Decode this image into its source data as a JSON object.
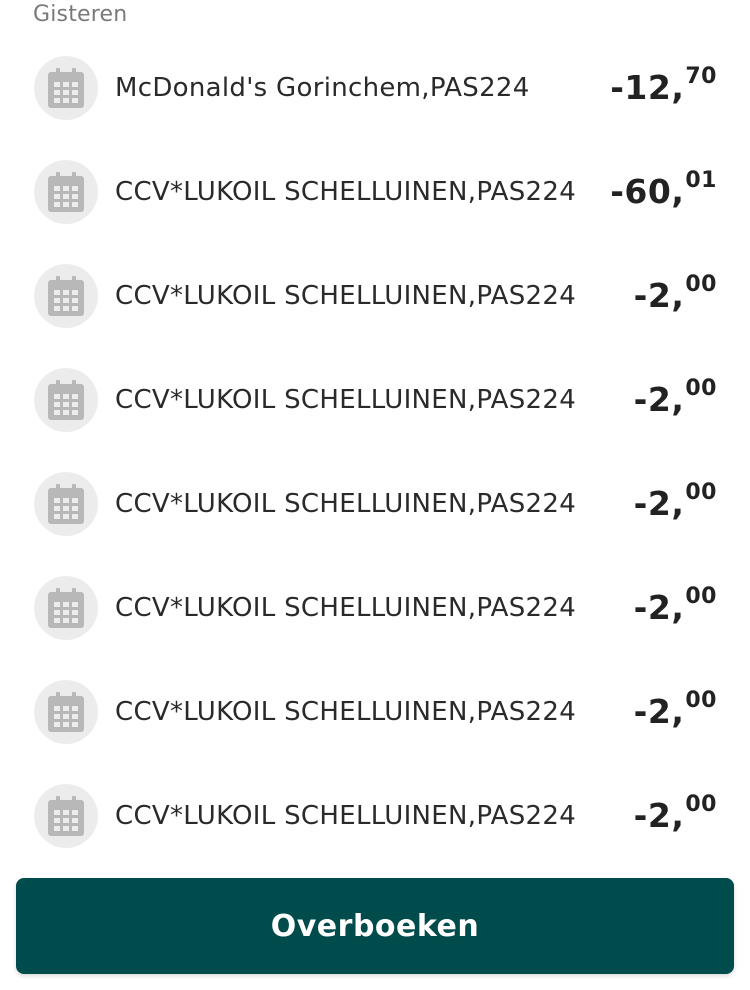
{
  "section": {
    "header": "Gisteren"
  },
  "transactions": [
    {
      "description": "McDonald's Gorinchem,PAS224",
      "amount_main": "-12,",
      "amount_cents": "70",
      "icon": "calendar-icon"
    },
    {
      "description": "CCV*LUKOIL SCHELLUINEN,PAS224",
      "amount_main": "-60,",
      "amount_cents": "01",
      "icon": "calendar-icon"
    },
    {
      "description": "CCV*LUKOIL SCHELLUINEN,PAS224",
      "amount_main": "-2,",
      "amount_cents": "00",
      "icon": "calendar-icon"
    },
    {
      "description": "CCV*LUKOIL SCHELLUINEN,PAS224",
      "amount_main": "-2,",
      "amount_cents": "00",
      "icon": "calendar-icon"
    },
    {
      "description": "CCV*LUKOIL SCHELLUINEN,PAS224",
      "amount_main": "-2,",
      "amount_cents": "00",
      "icon": "calendar-icon"
    },
    {
      "description": "CCV*LUKOIL SCHELLUINEN,PAS224",
      "amount_main": "-2,",
      "amount_cents": "00",
      "icon": "calendar-icon"
    },
    {
      "description": "CCV*LUKOIL SCHELLUINEN,PAS224",
      "amount_main": "-2,",
      "amount_cents": "00",
      "icon": "calendar-icon"
    },
    {
      "description": "CCV*LUKOIL SCHELLUINEN,PAS224",
      "amount_main": "-2,",
      "amount_cents": "00",
      "icon": "calendar-icon"
    }
  ],
  "action": {
    "transfer_label": "Overboeken"
  },
  "colors": {
    "primary_button": "#004b4b",
    "icon_background": "#ececec",
    "icon_glyph": "#b8b8b8",
    "section_header": "#7a7a7a"
  }
}
